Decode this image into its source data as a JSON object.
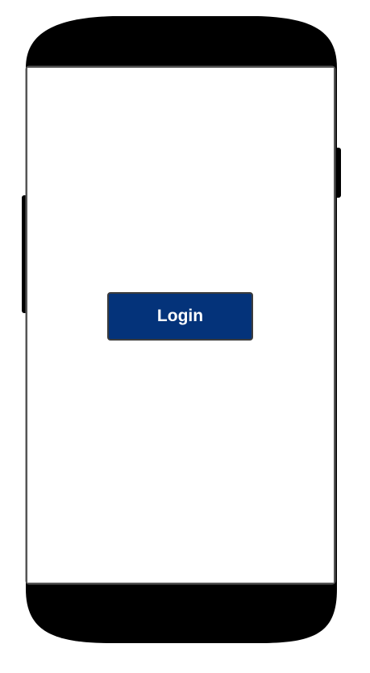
{
  "screen": {
    "login_button_label": "Login"
  },
  "colors": {
    "device_body": "#000000",
    "screen_background": "#ffffff",
    "screen_border": "#555555",
    "button_background": "#04337a",
    "button_border": "#3c3c3c",
    "button_text": "#ffffff"
  }
}
